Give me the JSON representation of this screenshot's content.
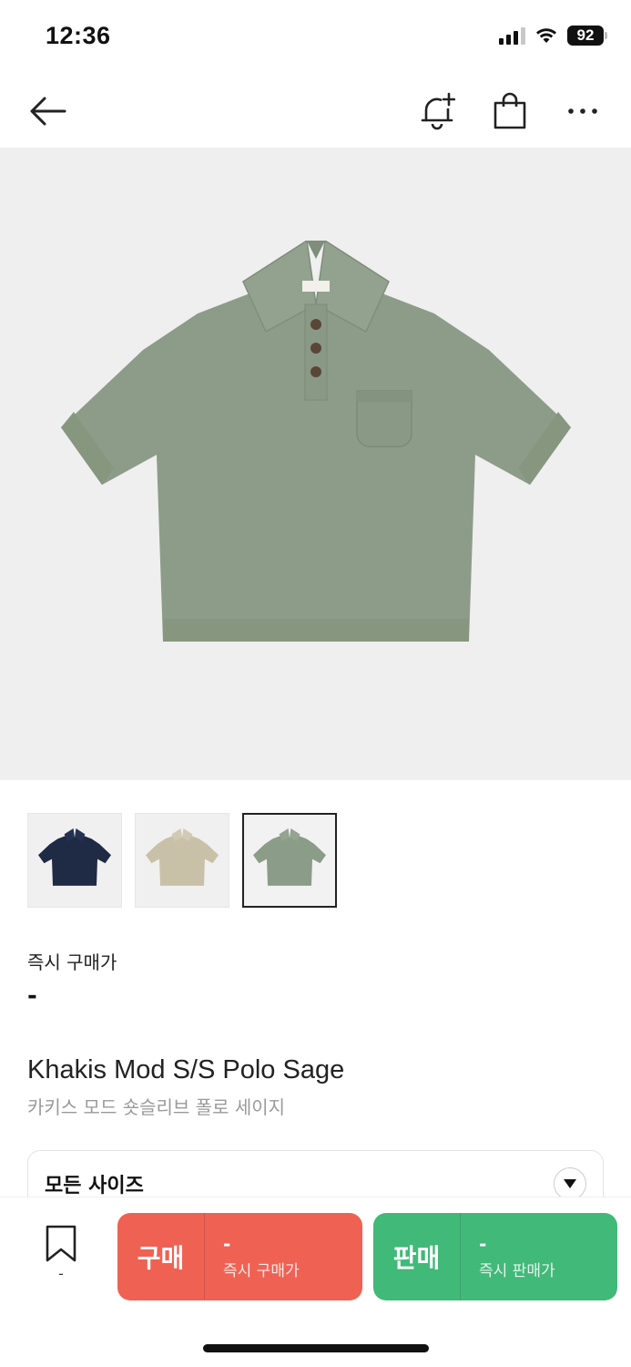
{
  "status_bar": {
    "time": "12:36",
    "battery": "92"
  },
  "nav": {
    "back_icon": "arrow-left-icon",
    "alert_icon": "bell-plus-icon",
    "cart_icon": "shopping-bag-icon",
    "more_icon": "more-horizontal-icon"
  },
  "product": {
    "image_alt": "sage polo shirt",
    "colors": [
      "#1f2a44",
      "#c9c0a8",
      "#8b9c88"
    ],
    "price_label": "즉시 구매가",
    "price_value": "-",
    "title_en": "Khakis Mod S/S Polo Sage",
    "title_ko": "카키스 모드 숏슬리브 폴로 세이지"
  },
  "size_select": {
    "label": "모든 사이즈"
  },
  "bottom_bar": {
    "wish_count": "-",
    "buy": {
      "label": "구매",
      "price": "-",
      "sub": "즉시 구매가",
      "color": "#ef6253"
    },
    "sell": {
      "label": "판매",
      "price": "-",
      "sub": "즉시 판매가",
      "color": "#41b979"
    }
  }
}
